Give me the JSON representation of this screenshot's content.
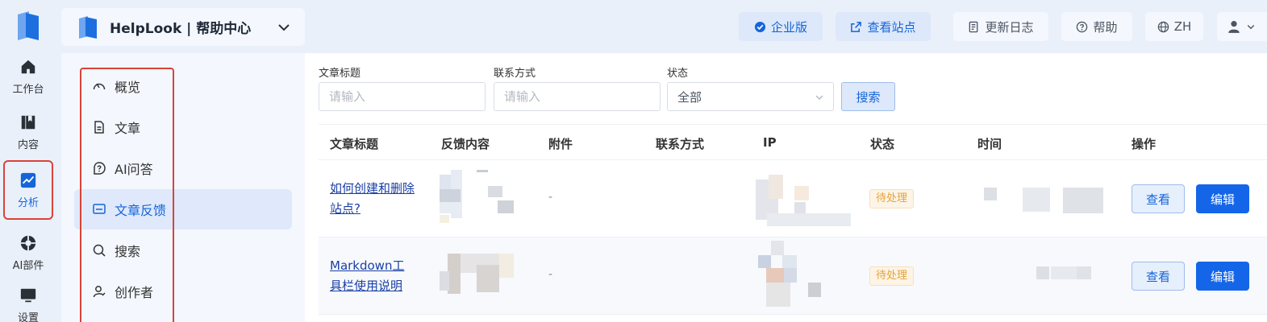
{
  "rail": {
    "items": [
      {
        "label": "工作台",
        "icon": "home-icon"
      },
      {
        "label": "内容",
        "icon": "book-icon"
      },
      {
        "label": "分析",
        "icon": "analytics-icon"
      },
      {
        "label": "AI部件",
        "icon": "ai-widget-icon"
      },
      {
        "label": "设置",
        "icon": "monitor-icon"
      }
    ],
    "active_index": 2
  },
  "brand": {
    "title": "HelpLook | 帮助中心"
  },
  "topbar": {
    "enterprise": "企业版",
    "view_site": "查看站点",
    "changelog": "更新日志",
    "help": "帮助",
    "language": "ZH"
  },
  "subnav": {
    "items": [
      {
        "label": "概览",
        "icon": "gauge-icon"
      },
      {
        "label": "文章",
        "icon": "document-icon"
      },
      {
        "label": "AI问答",
        "icon": "ai-question-icon"
      },
      {
        "label": "文章反馈",
        "icon": "feedback-icon"
      },
      {
        "label": "搜索",
        "icon": "search-icon"
      },
      {
        "label": "创作者",
        "icon": "user-icon"
      }
    ],
    "active_index": 3
  },
  "filters": {
    "title_label": "文章标题",
    "title_placeholder": "请输入",
    "contact_label": "联系方式",
    "contact_placeholder": "请输入",
    "status_label": "状态",
    "status_value": "全部",
    "search_button": "搜索"
  },
  "table": {
    "headers": [
      "文章标题",
      "反馈内容",
      "附件",
      "联系方式",
      "IP",
      "状态",
      "时间",
      "操作"
    ],
    "rows": [
      {
        "title_line1": "如何创建和删除",
        "title_line2": "站点?",
        "attachment": "-",
        "status": "待处理",
        "view": "查看",
        "edit": "编辑"
      },
      {
        "title_line1": "Markdown工",
        "title_line2": "具栏使用说明",
        "attachment": "-",
        "status": "待处理",
        "view": "查看",
        "edit": "编辑"
      }
    ]
  },
  "colors": {
    "accent": "#1565d8",
    "highlight_frame": "#d9433a",
    "pending": "#e4a23a"
  }
}
